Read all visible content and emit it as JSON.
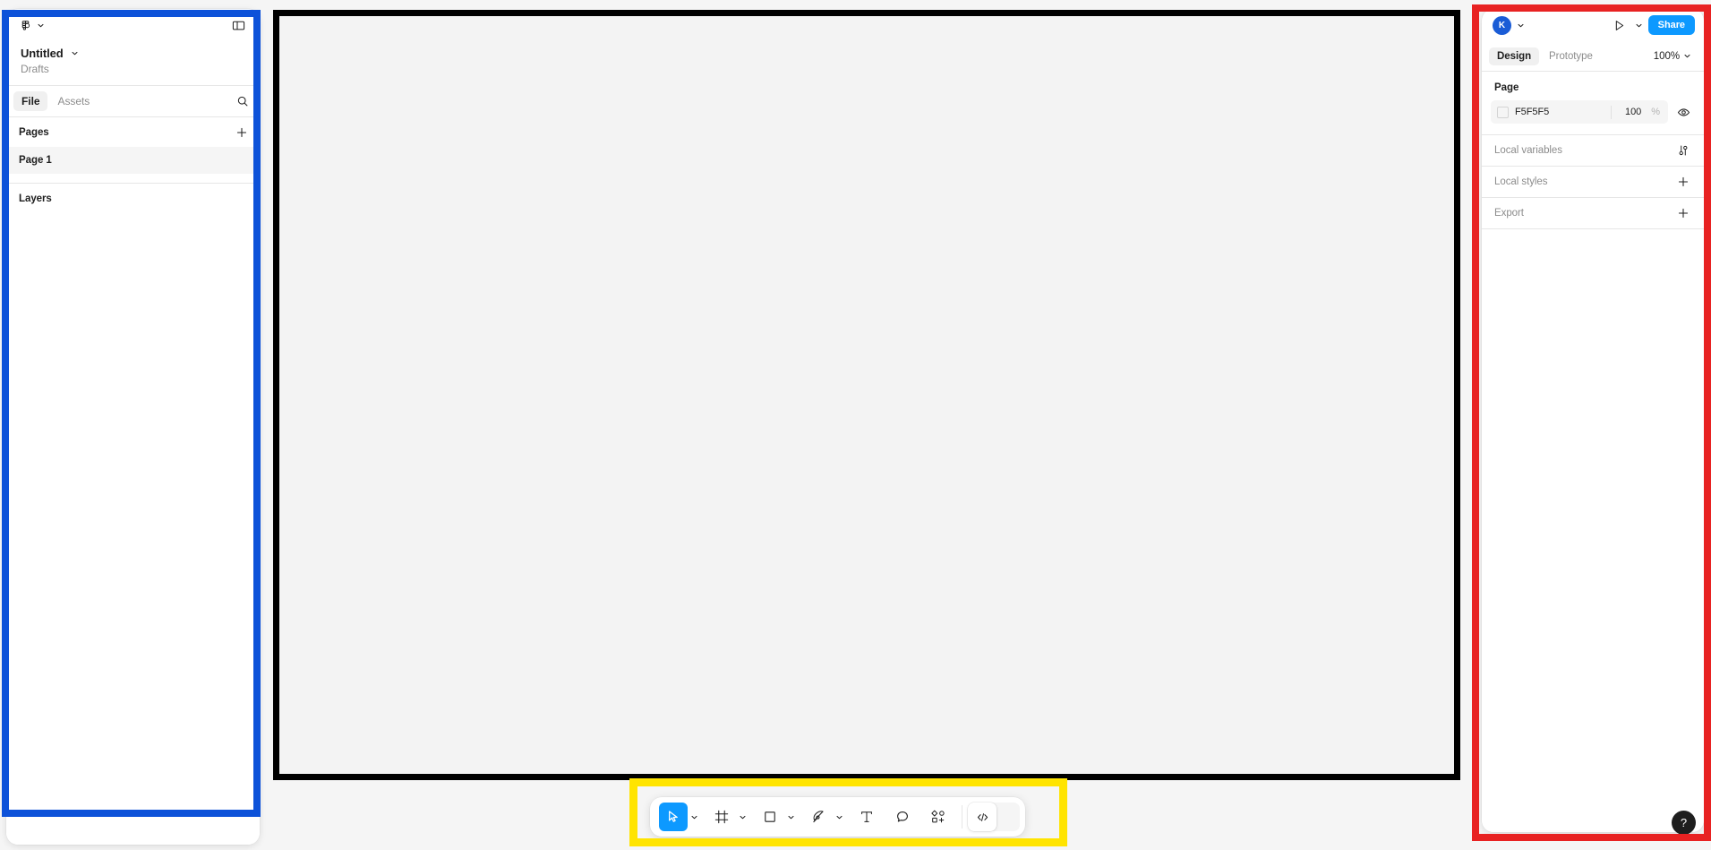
{
  "app": {
    "name": "Figma",
    "canvas_background": "#F3F3F3"
  },
  "left_panel": {
    "menu_icon": "figma-logo-icon",
    "menu_caret_icon": "chevron-down-icon",
    "toggle_sidebar_icon": "panel-toggle-icon",
    "file_name": "Untitled",
    "file_name_caret_icon": "chevron-down-icon",
    "breadcrumb": "Drafts",
    "tabs": [
      {
        "label": "File",
        "active": true
      },
      {
        "label": "Assets",
        "active": false
      }
    ],
    "search_icon": "search-icon",
    "pages_section": {
      "label": "Pages",
      "add_icon": "plus-icon",
      "items": [
        {
          "label": "Page 1",
          "selected": true
        }
      ]
    },
    "layers_section": {
      "label": "Layers",
      "items": []
    },
    "highlight_color": "#0D52D9"
  },
  "right_panel": {
    "avatar_initial": "K",
    "avatar_color": "#1A5CD6",
    "avatar_caret_icon": "chevron-down-icon",
    "present_icon": "play-icon",
    "present_caret_icon": "chevron-down-icon",
    "share_label": "Share",
    "share_color": "#0D99FF",
    "tabs": [
      {
        "label": "Design",
        "active": true
      },
      {
        "label": "Prototype",
        "active": false
      }
    ],
    "zoom_level": "100%",
    "zoom_caret_icon": "chevron-down-icon",
    "page_section": {
      "title": "Page",
      "fill": {
        "swatch_color": "#F5F5F5",
        "hex": "F5F5F5",
        "opacity": "100",
        "opacity_unit": "%",
        "visibility_icon": "eye-icon"
      }
    },
    "rows": [
      {
        "label": "Local variables",
        "icon": "sliders-icon"
      },
      {
        "label": "Local styles",
        "icon": "plus-icon"
      },
      {
        "label": "Export",
        "icon": "plus-icon"
      }
    ],
    "help_label": "?",
    "highlight_color": "#E82222"
  },
  "toolbar": {
    "highlight_color": "#FFE400",
    "tools": [
      {
        "name": "move-tool",
        "icon": "cursor-icon",
        "active": true,
        "has_caret": true
      },
      {
        "name": "frame-tool",
        "icon": "frame-icon",
        "active": false,
        "has_caret": true
      },
      {
        "name": "shape-tool",
        "icon": "square-icon",
        "active": false,
        "has_caret": true
      },
      {
        "name": "pen-tool",
        "icon": "pen-icon",
        "active": false,
        "has_caret": true
      },
      {
        "name": "text-tool",
        "icon": "text-icon",
        "active": false,
        "has_caret": false
      },
      {
        "name": "comment-tool",
        "icon": "comment-icon",
        "active": false,
        "has_caret": false
      },
      {
        "name": "actions-tool",
        "icon": "plugins-icon",
        "active": false,
        "has_caret": false
      }
    ],
    "dev_mode": {
      "name": "dev-mode-toggle",
      "icon": "code-icon"
    }
  },
  "canvas": {
    "highlight_color": "#000000"
  }
}
